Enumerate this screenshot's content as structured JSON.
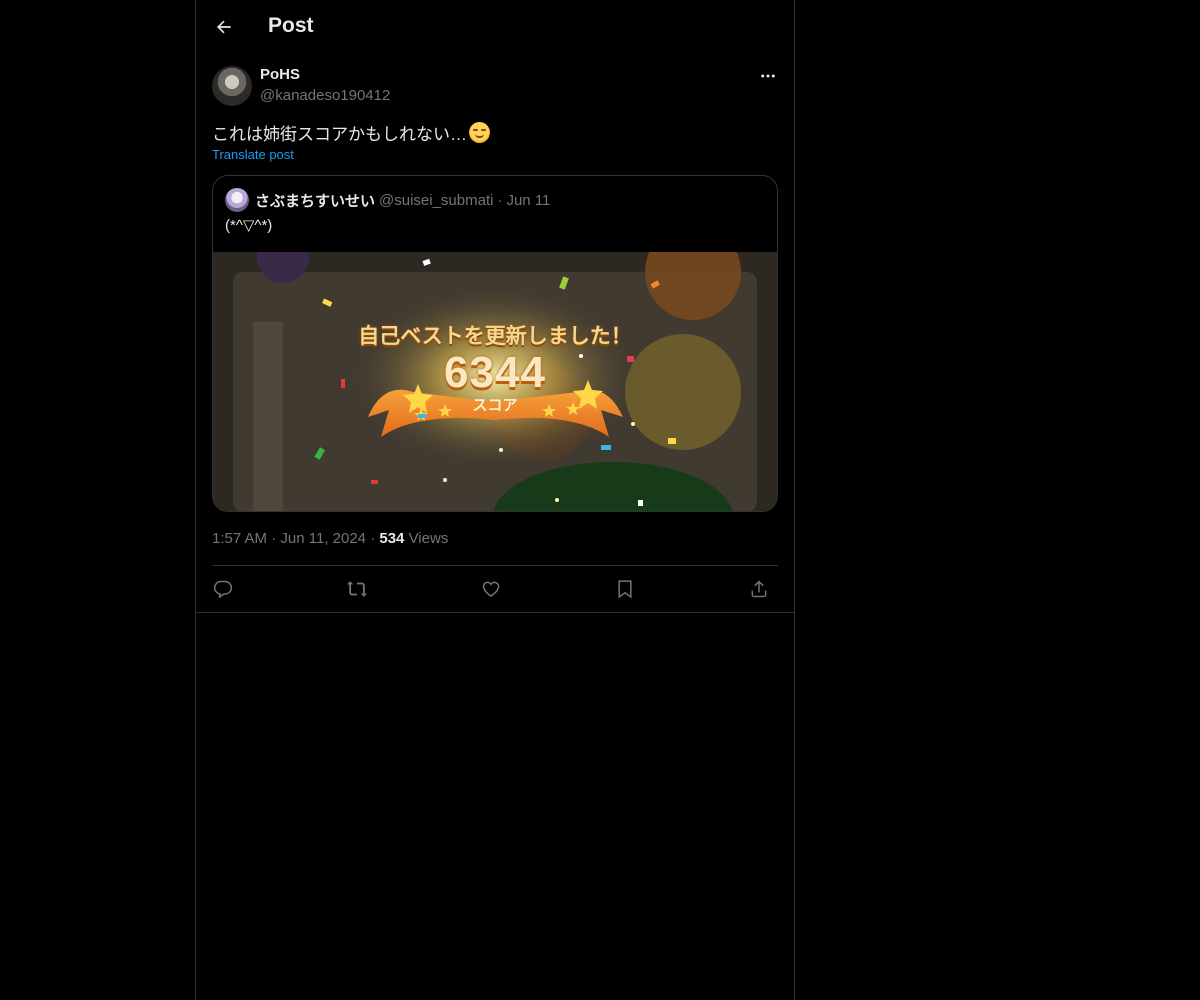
{
  "header": {
    "title": "Post",
    "back_icon": "arrow-left-icon"
  },
  "post": {
    "author_name": "PoHS",
    "author_handle": "@kanadeso190412",
    "text": "これは姉街スコアかもしれない…",
    "emoji": "smiling-face-icon",
    "translate_label": "Translate post",
    "time": "1:57 AM",
    "date": "Jun 11, 2024",
    "views_count": "534",
    "views_label": "Views",
    "separator": "·"
  },
  "quote": {
    "name": "さぶまちすいせい",
    "handle": "@suisei_submati",
    "separator": "·",
    "date": "Jun 11",
    "text": "(*^▽^*)",
    "media": {
      "banner_title": "自己ベストを更新しました！",
      "score": "6344",
      "score_label": "スコア"
    }
  },
  "actions": [
    {
      "name": "reply",
      "icon": "reply-icon"
    },
    {
      "name": "repost",
      "icon": "repost-icon"
    },
    {
      "name": "like",
      "icon": "heart-icon"
    },
    {
      "name": "bookmark",
      "icon": "bookmark-icon"
    },
    {
      "name": "share",
      "icon": "share-icon"
    }
  ],
  "colors": {
    "background": "#000000",
    "text": "#e7e9ea",
    "muted": "#71767b",
    "link": "#1d9bf0",
    "border": "#2f3336"
  }
}
